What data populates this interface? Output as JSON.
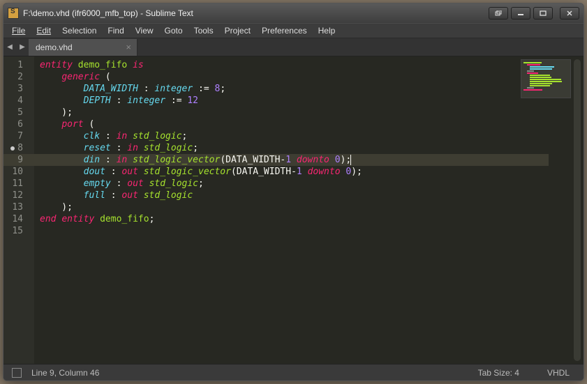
{
  "window": {
    "title": "F:\\demo.vhd (ifr6000_mfb_top) - Sublime Text"
  },
  "menu": {
    "file": "File",
    "edit": "Edit",
    "selection": "Selection",
    "find": "Find",
    "view": "View",
    "goto": "Goto",
    "tools": "Tools",
    "project": "Project",
    "preferences": "Preferences",
    "help": "Help"
  },
  "tabs": {
    "active": {
      "label": "demo.vhd"
    }
  },
  "gutter": {
    "line_count": 15,
    "active_line": 9,
    "modified_lines": [
      8
    ]
  },
  "code_tokens": [
    [
      [
        "kw",
        "entity"
      ],
      [
        "punc",
        " "
      ],
      [
        "name",
        "demo_fifo"
      ],
      [
        "punc",
        " "
      ],
      [
        "kw",
        "is"
      ]
    ],
    [
      [
        "punc",
        "    "
      ],
      [
        "kw",
        "generic"
      ],
      [
        "punc",
        " ("
      ]
    ],
    [
      [
        "punc",
        "        "
      ],
      [
        "id",
        "DATA_WIDTH"
      ],
      [
        "punc",
        " : "
      ],
      [
        "typei",
        "integer"
      ],
      [
        "punc",
        " := "
      ],
      [
        "num",
        "8"
      ],
      [
        "punc",
        ";"
      ]
    ],
    [
      [
        "punc",
        "        "
      ],
      [
        "id",
        "DEPTH"
      ],
      [
        "punc",
        " : "
      ],
      [
        "typei",
        "integer"
      ],
      [
        "punc",
        " := "
      ],
      [
        "num",
        "12"
      ]
    ],
    [
      [
        "punc",
        "    );"
      ]
    ],
    [
      [
        "punc",
        "    "
      ],
      [
        "kw",
        "port"
      ],
      [
        "punc",
        " ("
      ]
    ],
    [
      [
        "punc",
        "        "
      ],
      [
        "id",
        "clk"
      ],
      [
        "punc",
        " : "
      ],
      [
        "kw",
        "in"
      ],
      [
        "punc",
        " "
      ],
      [
        "type",
        "std_logic"
      ],
      [
        "punc",
        ";"
      ]
    ],
    [
      [
        "punc",
        "        "
      ],
      [
        "id",
        "reset"
      ],
      [
        "punc",
        " : "
      ],
      [
        "kw",
        "in"
      ],
      [
        "punc",
        " "
      ],
      [
        "type",
        "std_logic"
      ],
      [
        "punc",
        ";"
      ]
    ],
    [
      [
        "punc",
        "        "
      ],
      [
        "id",
        "din"
      ],
      [
        "punc",
        " : "
      ],
      [
        "kw",
        "in"
      ],
      [
        "punc",
        " "
      ],
      [
        "type",
        "std_logic_vector"
      ],
      [
        "punc",
        "("
      ],
      [
        "caps",
        "DATA_WIDTH"
      ],
      [
        "punc",
        "-"
      ],
      [
        "num",
        "1"
      ],
      [
        "punc",
        " "
      ],
      [
        "kw",
        "downto"
      ],
      [
        "punc",
        " "
      ],
      [
        "num",
        "0"
      ],
      [
        "punc",
        ");"
      ]
    ],
    [
      [
        "punc",
        "        "
      ],
      [
        "id",
        "dout"
      ],
      [
        "punc",
        " : "
      ],
      [
        "kw",
        "out"
      ],
      [
        "punc",
        " "
      ],
      [
        "type",
        "std_logic_vector"
      ],
      [
        "punc",
        "("
      ],
      [
        "caps",
        "DATA_WIDTH"
      ],
      [
        "punc",
        "-"
      ],
      [
        "num",
        "1"
      ],
      [
        "punc",
        " "
      ],
      [
        "kw",
        "downto"
      ],
      [
        "punc",
        " "
      ],
      [
        "num",
        "0"
      ],
      [
        "punc",
        ");"
      ]
    ],
    [
      [
        "punc",
        "        "
      ],
      [
        "id",
        "empty"
      ],
      [
        "punc",
        " : "
      ],
      [
        "kw",
        "out"
      ],
      [
        "punc",
        " "
      ],
      [
        "type",
        "std_logic"
      ],
      [
        "punc",
        ";"
      ]
    ],
    [
      [
        "punc",
        "        "
      ],
      [
        "id",
        "full"
      ],
      [
        "punc",
        " : "
      ],
      [
        "kw",
        "out"
      ],
      [
        "punc",
        " "
      ],
      [
        "type",
        "std_logic"
      ]
    ],
    [
      [
        "punc",
        "    );"
      ]
    ],
    [
      [
        "kw",
        "end"
      ],
      [
        "punc",
        " "
      ],
      [
        "kw",
        "entity"
      ],
      [
        "punc",
        " "
      ],
      [
        "name",
        "demo_fifo"
      ],
      [
        "punc",
        ";"
      ]
    ],
    []
  ],
  "status": {
    "cursor": "Line 9, Column 46",
    "tabsize": "Tab Size: 4",
    "syntax": "VHDL"
  }
}
